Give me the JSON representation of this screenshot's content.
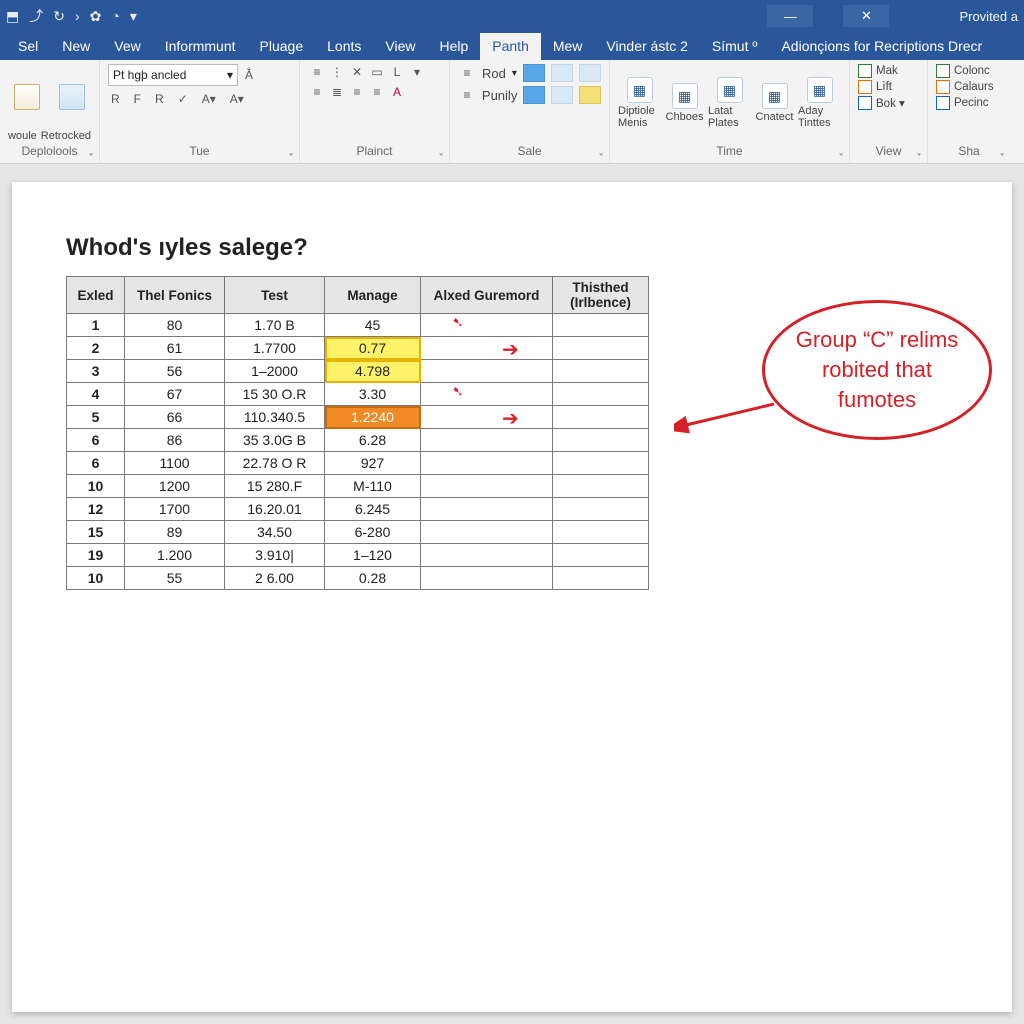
{
  "titlebar": {
    "app_hint": "Provited a"
  },
  "menu": {
    "tabs": [
      "Sel",
      "New",
      "Vew",
      "Informmunt",
      "Pluage",
      "Lonts",
      "View",
      "Help",
      "Panth",
      "Mew",
      "Vinder ástc 2",
      "Símut º",
      "Adionçions for Recriptions Drecr"
    ],
    "active_index": 8
  },
  "ribbon": {
    "groups": {
      "clipboard": {
        "label": "Deplolools",
        "btn1": "woule",
        "btn2": "Retrocked"
      },
      "font": {
        "label": "Tue",
        "font_name": "Pt hgþ ancled",
        "row2": [
          "R",
          "F",
          "R",
          "✓",
          "A▾",
          "A▾"
        ]
      },
      "paragraph": {
        "label": "Plainct"
      },
      "styles": {
        "label": "Sale",
        "rod": "Rod",
        "punily": "Punily"
      },
      "time": {
        "label": "Time",
        "items": [
          "Diptiole Menis",
          "Chboes",
          "Latat Plates",
          "Cnatect",
          "Aday Tinttes"
        ]
      },
      "view": {
        "label": "View",
        "items": [
          "Mak",
          "Lìft",
          "Bok ▾"
        ]
      },
      "share": {
        "label": "Sha",
        "items": [
          "Colonc",
          "Calaurs",
          "Pecinc"
        ]
      }
    }
  },
  "document": {
    "title": "Whod's ıyles salege?",
    "columns": [
      "Exled",
      "Thel Fonics",
      "Test",
      "Manage",
      "Alxed Guremord",
      "Thisthed (Irlbence)"
    ],
    "rows": [
      {
        "exled": "1",
        "fon": "80",
        "test": "1.70 B",
        "man": "45",
        "hi": "",
        "arrow": "hand"
      },
      {
        "exled": "2",
        "fon": "61",
        "test": "1.7700",
        "man": "0.77",
        "hi": "yellow",
        "arrow": "right"
      },
      {
        "exled": "3",
        "fon": "56",
        "test": "1–2000",
        "man": "4.798",
        "hi": "yellow",
        "arrow": ""
      },
      {
        "exled": "4",
        "fon": "67",
        "test": "15 30 O.R",
        "man": "3.30",
        "hi": "",
        "arrow": "hand"
      },
      {
        "exled": "5",
        "fon": "66",
        "test": "110.340.5",
        "man": "1.2240",
        "hi": "orange",
        "arrow": "right"
      },
      {
        "exled": "6",
        "fon": "86",
        "test": "35 3.0G B",
        "man": "6.28",
        "hi": "",
        "arrow": ""
      },
      {
        "exled": "6",
        "fon": "1100",
        "test": "22.78 O R",
        "man": "927",
        "hi": "",
        "arrow": ""
      },
      {
        "exled": "10",
        "fon": "1200",
        "test": "15 280.F",
        "man": "M-110",
        "hi": "",
        "arrow": ""
      },
      {
        "exled": "12",
        "fon": "1700",
        "test": "16.20.01",
        "man": "6.245",
        "hi": "",
        "arrow": ""
      },
      {
        "exled": "15",
        "fon": "89",
        "test": "34.50",
        "man": "6-280",
        "hi": "",
        "arrow": ""
      },
      {
        "exled": "19",
        "fon": "1.200",
        "test": "3.910|",
        "man": "1–120",
        "hi": "",
        "arrow": ""
      },
      {
        "exled": "10",
        "fon": "55",
        "test": "2 6.00",
        "man": "0.28",
        "hi": "",
        "arrow": ""
      }
    ],
    "callout": "Group “C” relims robited that fumotes"
  }
}
